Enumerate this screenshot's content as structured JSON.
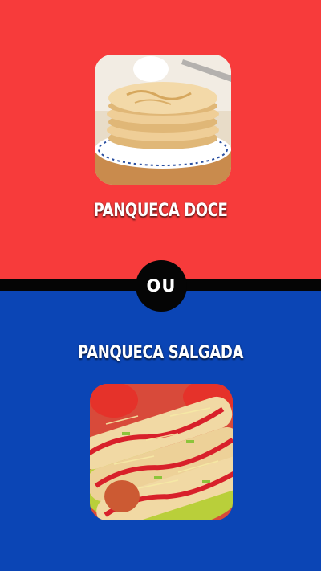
{
  "options": {
    "top": {
      "label": "PANQUECA DOCE",
      "image_icon": "sweet-pancake-stack",
      "background": "#f73b3b"
    },
    "bottom": {
      "label": "PANQUECA SALGADA",
      "image_icon": "savory-pancake-rolls",
      "background": "#0b45b5"
    }
  },
  "separator": {
    "label": "OU",
    "color": "#050505"
  }
}
